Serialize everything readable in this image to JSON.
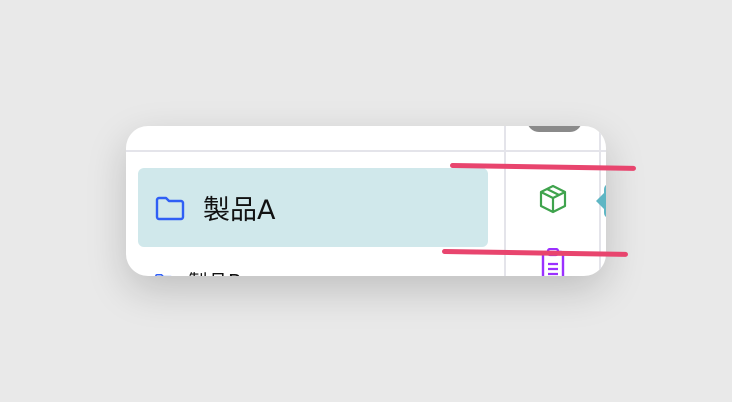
{
  "list": {
    "selected_item": {
      "label": "製品A",
      "icon": "folder-icon"
    },
    "next_item": {
      "label": "製品B",
      "icon": "folder-icon"
    }
  },
  "side_icons": [
    "package-icon",
    "document-icon"
  ],
  "colors": {
    "selected_bg": "#d0e8eb",
    "annotation": "#e8456e",
    "folder": "#2f5ff5",
    "package": "#3fa34d",
    "document": "#9b30ff"
  }
}
